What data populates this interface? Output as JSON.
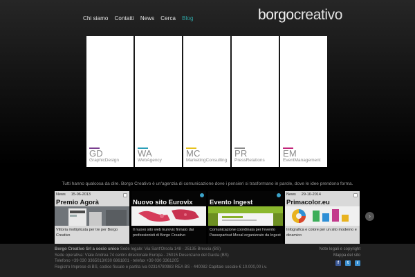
{
  "nav": {
    "items": [
      "Chi siamo",
      "Contatti",
      "News",
      "Cerca",
      "Blog"
    ]
  },
  "logo": {
    "part1": "borgo",
    "part2": "creativo"
  },
  "services": [
    {
      "abbr": "GD",
      "label": "GraphicDesign",
      "color": "#7a3f8f"
    },
    {
      "abbr": "WA",
      "label": "WebAgency",
      "color": "#2b9fb8"
    },
    {
      "abbr": "MC",
      "label": "MarketingConsulting",
      "color": "#e6c21e"
    },
    {
      "abbr": "PR",
      "label": "PressRelations",
      "color": "#8a8a8a"
    },
    {
      "abbr": "EM",
      "label": "EventManagement",
      "color": "#c2257a"
    }
  ],
  "tagline": "Tutti hanno qualcosa da dire. Borgo Creativo è un'agenzia di comunicazione dove i pensieri si trasformano in parole, dove le idee prendono forma.",
  "news": [
    {
      "category": "News",
      "date": "15-06-2013",
      "title": "Premio Agorà",
      "text": "Vittoria moltiplicata per tre per Borgo Creativo"
    },
    {
      "category": "",
      "date": "",
      "title": "Nuovo sito Eurovix",
      "text": "Il nuovo sito web Eurovix firmato dai professionisti di Borgo Creativo"
    },
    {
      "category": "",
      "date": "",
      "title": "Evento Ingest",
      "text": "Comunicazione coordinata per l'evento Passepartout Mexal organizzato da Ingest"
    },
    {
      "category": "News",
      "date": "29-10-2014",
      "title": "Primacolor.eu",
      "text": "Infografica e colore per un sito moderno e dinamico"
    }
  ],
  "next_icon": "chevron-right-icon",
  "footer": {
    "line1_bold": "Borgo Creativo Srl a socio unico",
    "line1": " Sede legale: Via Sant'Orsola 148 - 25135 Brescia (BS)",
    "line2": "Sede operativa: Viale Andrea 74 centro direzionale Europa - 25015 Desenzano del Garda (BS)",
    "line3": "Telefono +39 030 3365013/030 6861801 - telefax +39 030 3361205",
    "line4": "Registro Imprese di BS, codice fiscale e partita iva 02314780983 REA BS - 440082 Capitale sociale € 10.000,00 i.v.",
    "legal": "Note legali e copyright",
    "sitemap": "Mappa del sito",
    "social": [
      {
        "icon": "facebook-icon",
        "glyph": "f",
        "color": "#3b5998"
      },
      {
        "icon": "twitter-icon",
        "glyph": "t",
        "color": "#3a8fd0"
      },
      {
        "icon": "rss-icon",
        "glyph": "r",
        "color": "#3a8fd0"
      }
    ]
  }
}
